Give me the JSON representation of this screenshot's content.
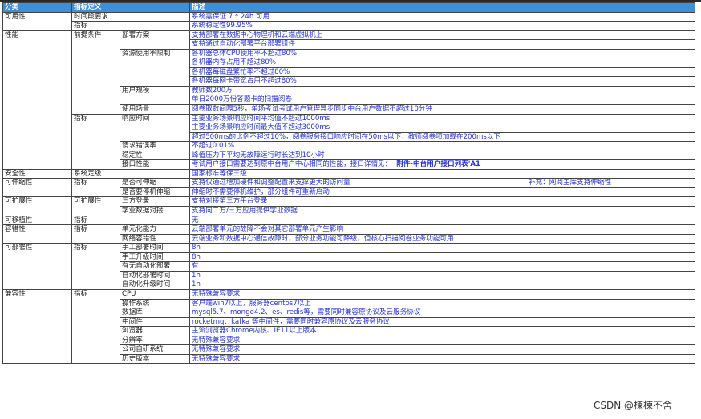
{
  "header": {
    "c1": "分类",
    "c2": "指标定义",
    "c4": "描述"
  },
  "rows": [
    {
      "c1": "可用性",
      "c2": "时间段要求",
      "c3": "",
      "c4": "系统需保证 7 * 24h 可用"
    },
    {
      "c1": "",
      "c2": "指标",
      "c3": "",
      "c4": "系统稳定性99.95%"
    },
    {
      "c1": "性能",
      "c2": "前提条件",
      "c3": "部署方案",
      "c4": "支持部署在数据中心物理机和云端虚拟机上"
    },
    {
      "c1": "",
      "c2": "",
      "c3": "",
      "c4": "支持通过自动化部署平台部署组件"
    },
    {
      "c1": "",
      "c2": "",
      "c3": "资源使用率限制",
      "c4": "各机器总体CPU使用率不超过80%"
    },
    {
      "c1": "",
      "c2": "",
      "c3": "",
      "c4": "各机器内存占用不超过80%"
    },
    {
      "c1": "",
      "c2": "",
      "c3": "",
      "c4": "各机器每磁盘繁忙率不超过80%"
    },
    {
      "c1": "",
      "c2": "",
      "c3": "",
      "c4": "各机器每网卡带宽占用不超过80%"
    },
    {
      "c1": "",
      "c2": "",
      "c3": "用户规模",
      "c4": "教师数200万"
    },
    {
      "c1": "",
      "c2": "",
      "c3": "",
      "c4": "单日2000万份答题卡的扫描阅卷"
    },
    {
      "c1": "",
      "c2": "",
      "c3": "使用场景",
      "c4": "阅卷取数间隔5秒，单场考试考试用户管理异步同步中台用户数据不超过10分钟"
    },
    {
      "c1": "",
      "c2": "指标",
      "c3": "响应时间",
      "c4": "主要业务场景响应时间平均值不超过1000ms"
    },
    {
      "c1": "",
      "c2": "",
      "c3": "",
      "c4": "主要业务场景响应时间最大值不超过3000ms"
    },
    {
      "c1": "",
      "c2": "",
      "c3": "",
      "c4": "超过500ms的比例不超过10%，阅卷服务接口响应时间在50ms以下，教师阅卷项加载在200ms以下"
    },
    {
      "c1": "",
      "c2": "",
      "c3": "请求错误率",
      "c4": "不超过0.01%"
    },
    {
      "c1": "",
      "c2": "",
      "c3": "稳定性",
      "c4": "峰值压力下平均无故障运行时长达到10小时"
    },
    {
      "c1": "",
      "c2": "",
      "c3": "接口性能",
      "c4": "考试用户接口需要达到原中台用户中心相同的性能，接口详情见：",
      "link": "附件-中台用户接口列表'A1"
    },
    {
      "c1": "安全性",
      "c2": "系统定级",
      "c3": "",
      "c4": "国家标准等保三级"
    },
    {
      "c1": "可伸缩性",
      "c2": "指标",
      "c3": "是否可伸缩",
      "c4": "支持仅通过增加硬件和调整配置来支撑更大的访问量",
      "note": "补充：网阅主库支持伸缩性"
    },
    {
      "c1": "",
      "c2": "",
      "c3": "是否要停机伸缩",
      "c4": "伸缩时不需要停机维护，部分组件可重新启动"
    },
    {
      "c1": "可扩展性",
      "c2": "可扩展性",
      "c3": "三方登录",
      "c4": "支持对接第三方平台登录"
    },
    {
      "c1": "",
      "c2": "",
      "c3": "学业数据对接",
      "c4": "支持向二方/三方应用提供学业数据"
    },
    {
      "c1": "可移植性",
      "c2": "指标",
      "c3": "",
      "c4": "无"
    },
    {
      "c1": "容错性",
      "c2": "指标",
      "c3": "单元化能力",
      "c4": "云端部署单元的故障不会对其它部署单元产生影响"
    },
    {
      "c1": "",
      "c2": "",
      "c3": "网络容错性",
      "c4": "云端业务和数据中心通信故障时，部分业务功能可降级，但核心扫描阅卷业务功能可用"
    },
    {
      "c1": "可部署性",
      "c2": "指标",
      "c3": "手工部署时间",
      "c4": "8h"
    },
    {
      "c1": "",
      "c2": "",
      "c3": "手工升级时间",
      "c4": "8h"
    },
    {
      "c1": "",
      "c2": "",
      "c3": "有无自动化部署",
      "c4": "有"
    },
    {
      "c1": "",
      "c2": "",
      "c3": "自动化部署时间",
      "c4": "1h"
    },
    {
      "c1": "",
      "c2": "",
      "c3": "自动化升级时间",
      "c4": "1h"
    },
    {
      "c1": "兼容性",
      "c2": "指标",
      "c3": "CPU",
      "c4": "无特殊兼容要求"
    },
    {
      "c1": "",
      "c2": "",
      "c3": "操作系统",
      "c4": "客户端win7以上，服务器centos7以上"
    },
    {
      "c1": "",
      "c2": "",
      "c3": "数据库",
      "c4": "mysql5.7、mongo4.2、es、redis等，需要同时兼容原协议及云服务协议"
    },
    {
      "c1": "",
      "c2": "",
      "c3": "中间件",
      "c4": "rocketmq、kafka 等中间件，需要同时兼容原协议及云服务协议"
    },
    {
      "c1": "",
      "c2": "",
      "c3": "浏览器",
      "c4": "主流浏览器Chrome内核、IE11以上版本"
    },
    {
      "c1": "",
      "c2": "",
      "c3": "分辨率",
      "c4": "无特殊兼容要求"
    },
    {
      "c1": "",
      "c2": "",
      "c3": "公司自研系统",
      "c4": "无特殊兼容要求"
    },
    {
      "c1": "",
      "c2": "",
      "c3": "历史版本",
      "c4": "无特殊兼容要求"
    }
  ],
  "watermark": "CSDN @楝楝不舍"
}
